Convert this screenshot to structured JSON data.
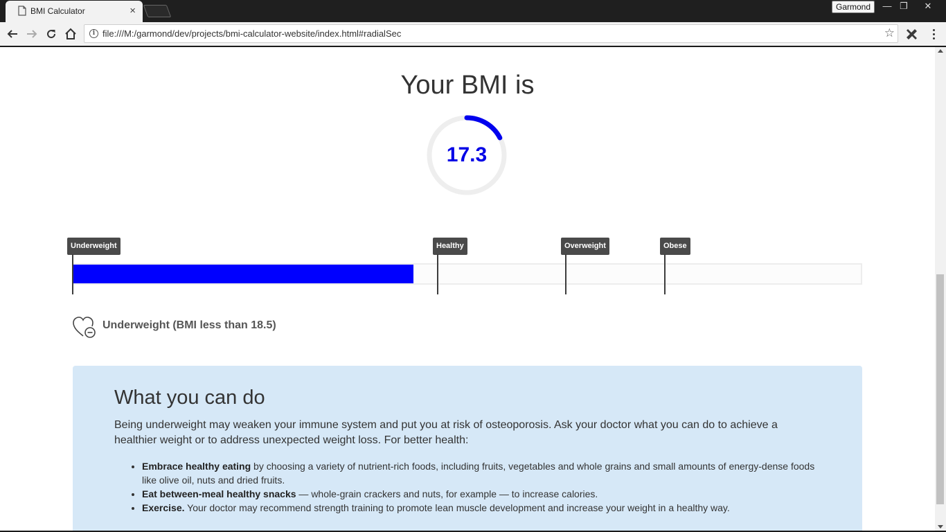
{
  "browser": {
    "tab_title": "BMI Calculator",
    "tab_close": "×",
    "profile_name": "Garmond",
    "url": "file:///M:/garmond/dev/projects/bmi-calculator-website/index.html#radialSec",
    "window_buttons": {
      "minimize": "—",
      "maximize": "❐",
      "close": "✕"
    }
  },
  "result": {
    "heading": "Your BMI is",
    "bmi_value": "17.3",
    "bmi_number": 17.3,
    "radial_fraction": 0.173,
    "accent_color": "#0000ff"
  },
  "scale": {
    "labels": [
      "Underweight",
      "Healthy",
      "Overweight",
      "Obese"
    ],
    "fill_fraction": 0.432
  },
  "category": {
    "icon": "heart-minus-icon",
    "text": "Underweight (BMI less than 18.5)"
  },
  "advice": {
    "title": "What you can do",
    "intro": "Being underweight may weaken your immune system and put you at risk of osteoporosis. Ask your doctor what you can do to achieve a healthier weight or to address unexpected weight loss. For better health:",
    "items": [
      {
        "bold": "Embrace healthy eating",
        "text": " by choosing a variety of nutrient-rich foods, including fruits, vegetables and whole grains and small amounts of energy-dense foods like olive oil, nuts and dried fruits."
      },
      {
        "bold": "Eat between-meal healthy snacks",
        "text": " — whole-grain crackers and nuts, for example — to increase calories."
      },
      {
        "bold": "Exercise.",
        "text": " Your doctor may recommend strength training to promote lean muscle development and increase your weight in a healthy way."
      }
    ],
    "background_color": "#d6e8f7"
  }
}
